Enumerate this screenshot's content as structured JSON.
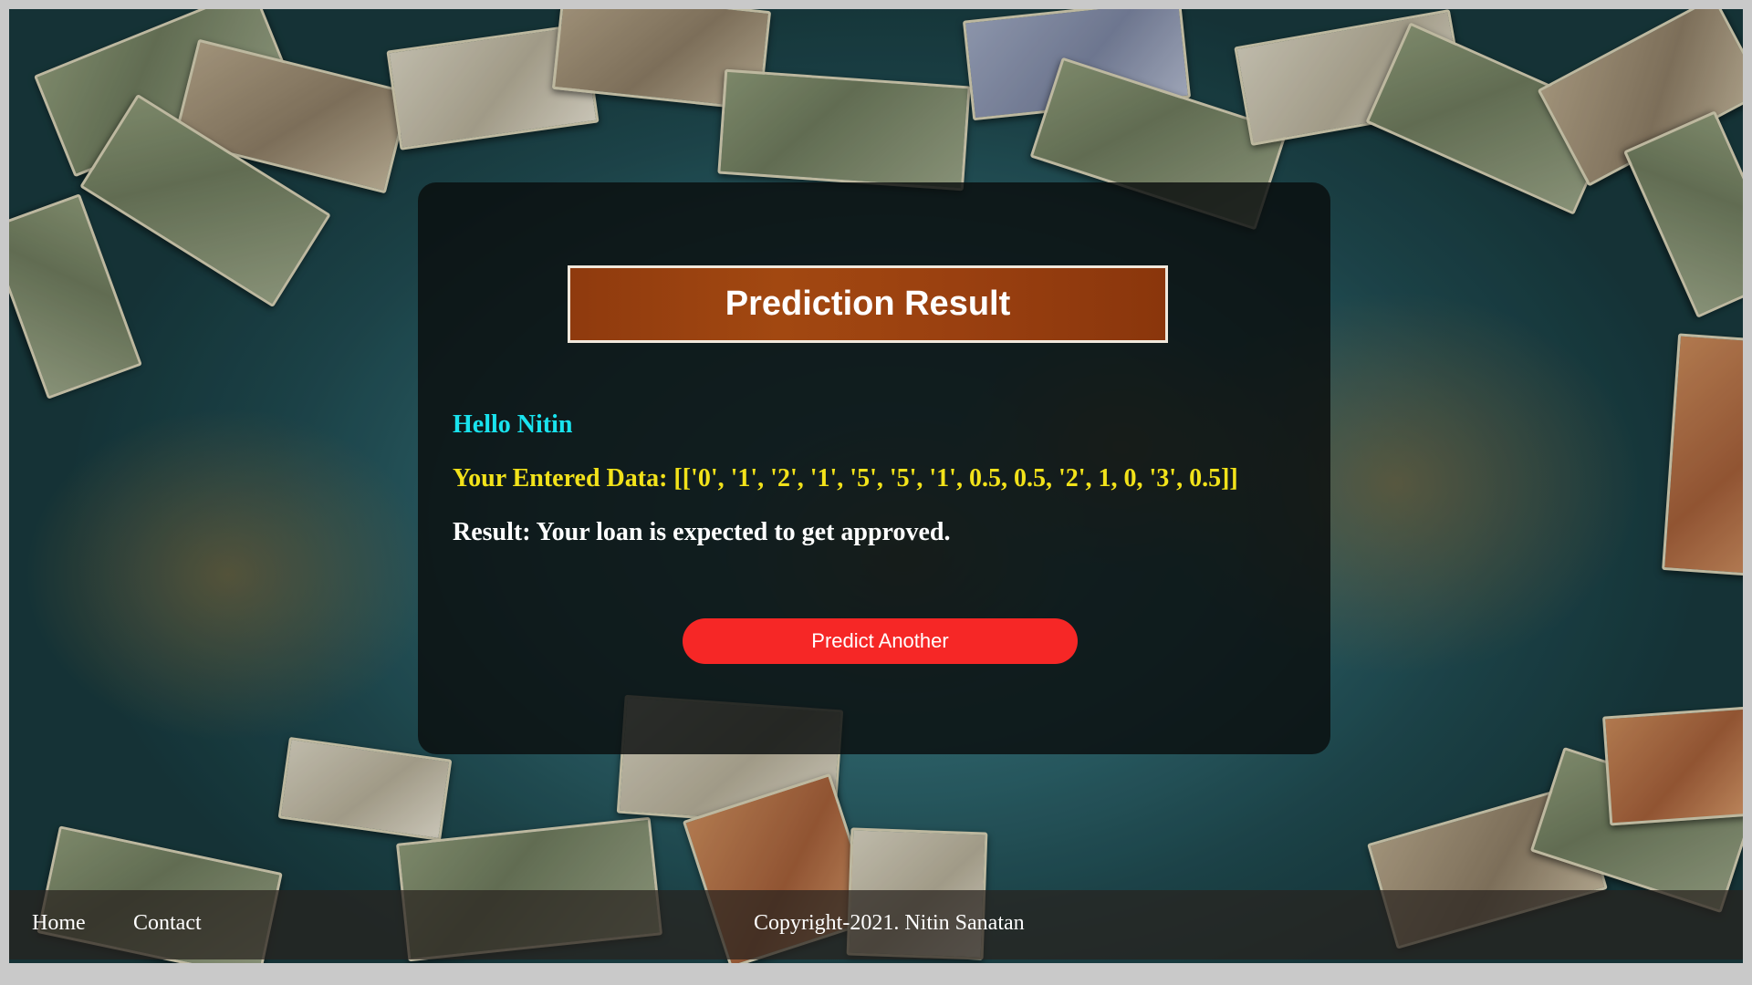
{
  "card": {
    "title": "Prediction Result",
    "greeting": "Hello Nitin",
    "entered_data": "Your Entered Data: [['0', '1', '2', '1', '5', '5', '1', 0.5, 0.5, '2', 1, 0, '3', 0.5]]",
    "result": "Result: Your loan is expected to get approved.",
    "button_label": "Predict Another"
  },
  "footer": {
    "links": [
      "Home",
      "Contact"
    ],
    "copyright": "Copyright-2021. Nitin Sanatan"
  },
  "colors": {
    "title_bg": "#9a4010",
    "greeting": "#19e3ee",
    "entered_data": "#f2e21a",
    "button": "#f62726"
  }
}
